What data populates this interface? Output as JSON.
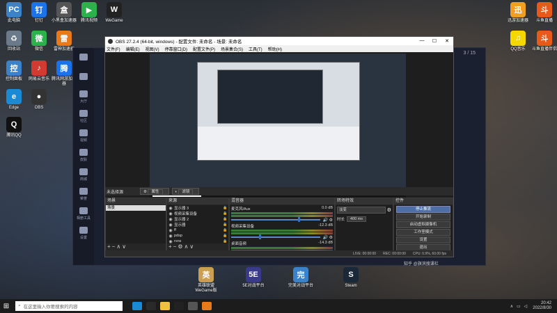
{
  "desktop_left": [
    {
      "label": "此电脑",
      "color": "#3b82c8",
      "glyph": "PC"
    },
    {
      "label": "钉钉",
      "color": "#1a73e8",
      "glyph": "钉"
    },
    {
      "label": "小黑盒加速器",
      "color": "#555555",
      "glyph": "盒"
    },
    {
      "label": "腾讯视频",
      "color": "#2bb24c",
      "glyph": "▶"
    },
    {
      "label": "WeGame",
      "color": "#222222",
      "glyph": "W"
    },
    {
      "label": "回收站",
      "color": "#6a7a8a",
      "glyph": "♻"
    },
    {
      "label": "微信",
      "color": "#2bb24c",
      "glyph": "微"
    },
    {
      "label": "雷神加速器",
      "color": "#e87a1a",
      "glyph": "雷"
    },
    {
      "label": "控制面板",
      "color": "#3b82c8",
      "glyph": "控"
    },
    {
      "label": "网易云音乐",
      "color": "#d33a31",
      "glyph": "♪"
    },
    {
      "label": "腾讯网游加速器",
      "color": "#1a73e8",
      "glyph": "腾"
    },
    {
      "label": "Edge",
      "color": "#1a8ad4",
      "glyph": "e"
    },
    {
      "label": "OBS",
      "color": "#333333",
      "glyph": "●"
    },
    {
      "label": "腾讯QQ",
      "color": "#111111",
      "glyph": "Q"
    }
  ],
  "desktop_right": [
    {
      "label": "迅游加速器",
      "color": "#f0a020",
      "glyph": "迅"
    },
    {
      "label": "斗鱼直播",
      "color": "#e85a1a",
      "glyph": "斗"
    },
    {
      "label": "QQ音乐",
      "color": "#f5d800",
      "glyph": "♫"
    },
    {
      "label": "斗鱼直播伴侣",
      "color": "#e85a1a",
      "glyph": "斗"
    }
  ],
  "desktop_bottom": [
    {
      "label": "英雄联盟WeGame版",
      "color": "#c8a050",
      "glyph": "英"
    },
    {
      "label": "5E对战平台",
      "color": "#3a3a8a",
      "glyph": "5E"
    },
    {
      "label": "完美对战平台",
      "color": "#3b82c8",
      "glyph": "完"
    },
    {
      "label": "Steam",
      "color": "#1b2838",
      "glyph": "S"
    }
  ],
  "bg_app": {
    "pager": "3 / 15",
    "sidebar": [
      "",
      "",
      "大厅",
      "社区",
      "视频",
      "皮肤",
      "商城",
      "荣誉",
      "相册工具",
      "设置"
    ]
  },
  "obs": {
    "title": "OBS 27.2.4 (64-bit, windows) - 配置文件: 未命名 - 场景: 未命名",
    "menu": [
      "文件(F)",
      "编辑(E)",
      "视图(V)",
      "停靠窗口(D)",
      "配置文件(P)",
      "场景集合(S)",
      "工具(T)",
      "帮助(H)"
    ],
    "no_source": "未选择源",
    "properties": "属性",
    "filters": "滤镜",
    "docks": {
      "scenes": {
        "title": "场景",
        "items": [
          "场景"
        ]
      },
      "sources": {
        "title": "来源",
        "items": [
          "显示器 3",
          "视频采集设备",
          "显示器 2",
          "显示器",
          "ff",
          "pdsp",
          "rsns"
        ]
      },
      "mixer": {
        "title": "混音器",
        "channels": [
          {
            "name": "麦克风/Aux",
            "db": "0.0 dB"
          },
          {
            "name": "视频采集设备",
            "db": "-12.3 dB"
          },
          {
            "name": "桌面音频",
            "db": "-14.3 dB"
          }
        ]
      },
      "transitions": {
        "title": "转场特效",
        "type": "淡变",
        "duration_label": "时长",
        "duration": "400 ms"
      },
      "controls": {
        "title": "控件",
        "buttons": [
          "停止推流",
          "开始录制",
          "启动虚拟摄像机",
          "工作室模式",
          "设置",
          "退出"
        ]
      }
    },
    "status": [
      "LIVE: 00:00:00",
      "REC: 00:00:00",
      "CPU: 0.9%, 60.00 fps"
    ]
  },
  "taskbar": {
    "search": "在这里输入你要搜索的内容",
    "time": "20:42",
    "date": "2022/8/30",
    "icons": [
      "#1a8ad4",
      "#2a2a2a",
      "#f0c040",
      "#222222",
      "#555555",
      "#e87a1a"
    ]
  },
  "watermark": "知乎 @旗滨搜课栏"
}
